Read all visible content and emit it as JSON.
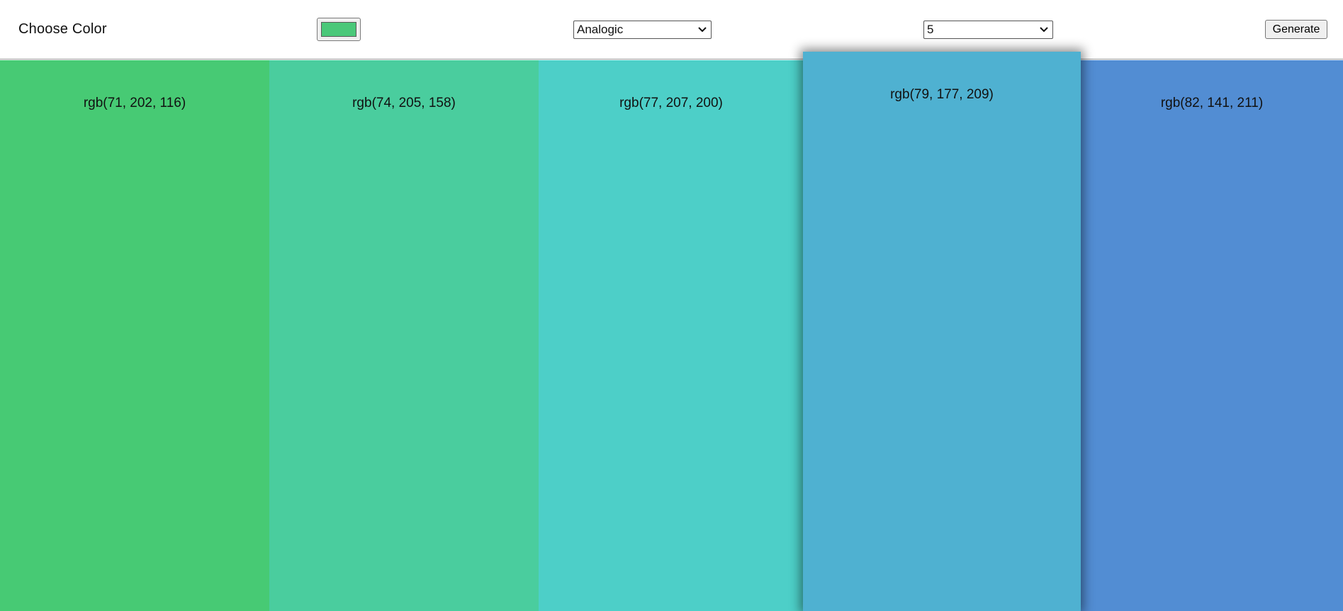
{
  "header": {
    "title": "Choose Color",
    "picked_color": "#4ac879",
    "mode_selected": "Analogic",
    "count_selected": "5",
    "generate_label": "Generate"
  },
  "palette": {
    "colors": [
      {
        "label": "rgb(71, 202, 116)",
        "hex": "#47ca74"
      },
      {
        "label": "rgb(74, 205, 158)",
        "hex": "#4acd9e"
      },
      {
        "label": "rgb(77, 207, 200)",
        "hex": "#4dcfc8"
      },
      {
        "label": "rgb(79, 177, 209)",
        "hex": "#4fb1d1",
        "highlighted": true
      },
      {
        "label": "rgb(82, 141, 211)",
        "hex": "#528dd3"
      }
    ]
  }
}
